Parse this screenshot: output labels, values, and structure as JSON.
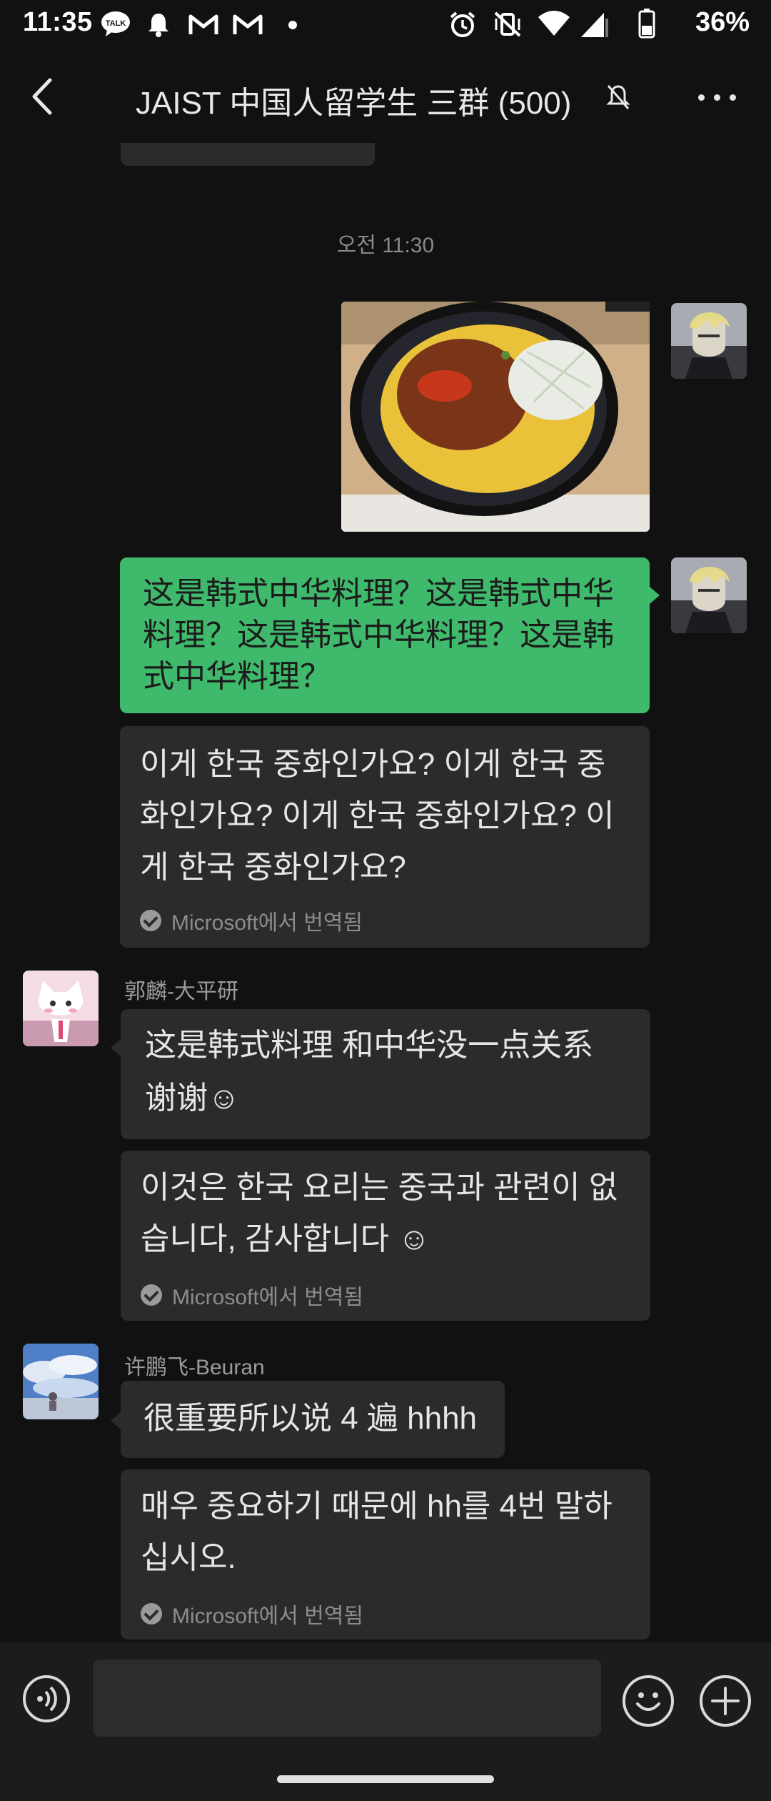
{
  "status_bar": {
    "time": "11:35",
    "talk_badge": "TALK",
    "battery_percent": "36%"
  },
  "header": {
    "title": "JAIST 中国人留学生 三群 (500)"
  },
  "chat": {
    "timestamp": "오전 11:30",
    "my_message": "这是韩式中华料理？这是韩式中华料理？这是韩式中华料理？这是韩式中华料理？",
    "my_message_translation": "이게 한국 중화인가요? 이게 한국 중화인가요? 이게 한국 중화인가요? 이게 한국 중화인가요?",
    "translation_note": "Microsoft에서 번역됨",
    "sender_1": "郭麟-大平研",
    "sender_1_message": "这是韩式料理 和中华没一点关系 谢谢☺",
    "sender_1_translation": "이것은 한국 요리는 중국과 관련이 없습니다, 감사합니다 ☺",
    "sender_2": "许鹏飞-Beuran",
    "sender_2_message": "很重要所以说 4 遍 hhhh",
    "sender_2_translation": "매우 중요하기 때문에 hh를 4번 말하십시오."
  },
  "colors": {
    "background": "#111111",
    "bubble_grey": "#2b2b2b",
    "bubble_green": "#3fb96b"
  }
}
